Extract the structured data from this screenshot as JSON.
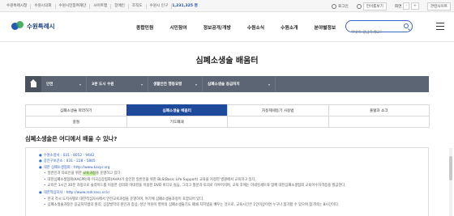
{
  "utility": {
    "links": [
      "수원특례시청",
      "수원시의회",
      "수원시민참여재단",
      "사이트맵",
      "장애인",
      "조직도"
    ],
    "population_label": "수원시 인구",
    "population_value": "1,231,325 명",
    "login": "로그인",
    "language": "언어를보기",
    "zoom_label": "화면",
    "zoom_minus": "-",
    "zoom_plus": "+",
    "related_sites": "관련사이트"
  },
  "header": {
    "logo_text": "수원특례시",
    "nav": [
      "종합민원",
      "시민참여",
      "정보공개/개방",
      "수원소식",
      "수원소개",
      "분야별정보"
    ],
    "search_placeholder": "무엇이 궁금하세요?"
  },
  "page": {
    "title": "심폐소생술 배움터"
  },
  "breadcrumb": {
    "items": [
      {
        "label": "안전",
        "caret": "▾"
      },
      {
        "label": "3분 도시 수원",
        "caret": "▾"
      },
      {
        "label": "생활안전 행동요령",
        "caret": "▾"
      },
      {
        "label": "심폐소생술 응급처치",
        "caret": "▾"
      }
    ]
  },
  "tabs": {
    "row1": [
      "심폐소생술 따라하기",
      "심폐소생술 배움터",
      "자동제세동기 사용법",
      "출혈과 쇼크"
    ],
    "row2": [
      "골절",
      "기도폐쇄",
      "",
      ""
    ],
    "active": "심폐소생술 배움터"
  },
  "section": {
    "title": "심폐소생술은 어디에서 배울 수 있나?",
    "lines": [
      "수원소방서 : 031 - 8052 - 9442",
      "장안구보건소 : 031 - 228 - 5805",
      "대한 심폐소생협회 : http://www.kacpr.org",
      "일반인과 의료인을 위한 교육과정을 운영하고 있다.",
      "대한심폐소생협회(KACPR)와 미국심장협회(AHA)가 승인한 일반인을 위한 BLS(Basic Life Support) 교육을 지정한 병원에서 교육하고 있다.",
      "교육은 1시간 30분 과정으로 슬라이드를 이용한 강의와 마네킹을 이용한 DVD 비디오 실습, 그리고 질문과 토의로 이루어지며, 교육 후에는 마네킹세트와 함께 대한심폐소생협회 교육이수자격증을 발급한다.",
      "대한적십자사 : http://www.redcross.or.kr",
      "한국 각시 도지사별로 대한적십자사에서 안전교육과정을 운영하며, 여기에 심폐소생술과정이 포함되어 있다.",
      "심폐소생술과정은 응급처치법의 원리, 심장발작의 원인과 증상, 성인 어린이 영아의 심폐소생술기도 폐쇄 처치법을 배우는 것으로, 교육시간은 1인이상이면 누구나 참가할 수 있으며 참가비는 8시간이다."
    ],
    "highlight_word": "교육과정"
  }
}
